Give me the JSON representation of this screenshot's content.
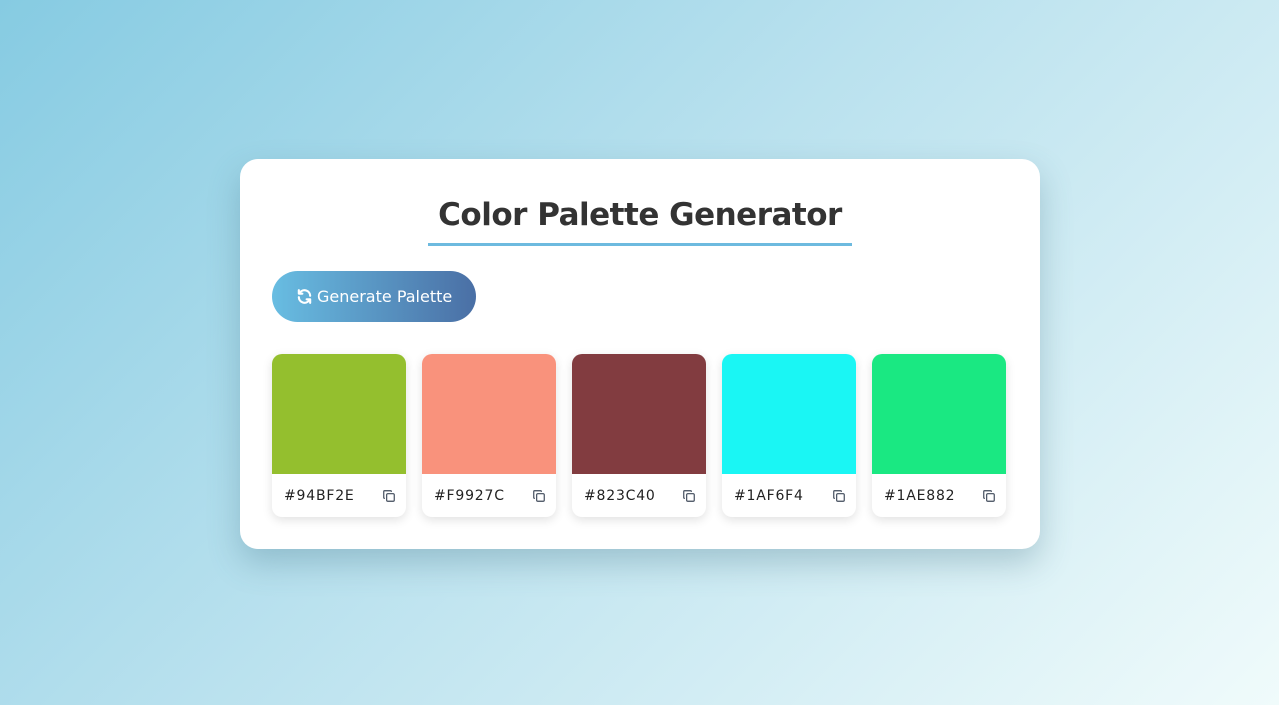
{
  "header": {
    "title": "Color Palette Generator"
  },
  "toolbar": {
    "generate_label": "Generate Palette",
    "generate_icon": "refresh-icon"
  },
  "palette": [
    {
      "hex": "#94BF2E",
      "color": "#94BF2E",
      "copy_icon": "copy-icon"
    },
    {
      "hex": "#F9927C",
      "color": "#F9927C",
      "copy_icon": "copy-icon"
    },
    {
      "hex": "#823C40",
      "color": "#823C40",
      "copy_icon": "copy-icon"
    },
    {
      "hex": "#1AF6F4",
      "color": "#1AF6F4",
      "copy_icon": "copy-icon"
    },
    {
      "hex": "#1AE882",
      "color": "#1AE882",
      "copy_icon": "copy-icon"
    }
  ],
  "colors": {
    "accent": "#6DBADF",
    "button_start": "#68BDE2",
    "button_end": "#4A6FA5",
    "title_text": "#333333"
  }
}
